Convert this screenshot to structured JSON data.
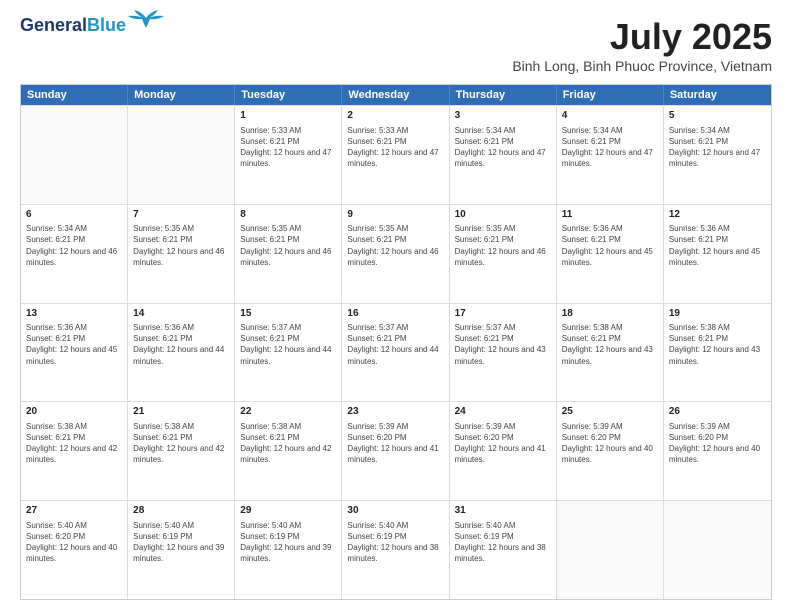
{
  "header": {
    "logo_line1": "General",
    "logo_line2": "Blue",
    "main_title": "July 2025",
    "subtitle": "Binh Long, Binh Phuoc Province, Vietnam"
  },
  "calendar": {
    "days_of_week": [
      "Sunday",
      "Monday",
      "Tuesday",
      "Wednesday",
      "Thursday",
      "Friday",
      "Saturday"
    ],
    "weeks": [
      [
        {
          "day": "",
          "empty": true
        },
        {
          "day": "",
          "empty": true
        },
        {
          "day": "1",
          "sunrise": "5:33 AM",
          "sunset": "6:21 PM",
          "daylight": "12 hours and 47 minutes."
        },
        {
          "day": "2",
          "sunrise": "5:33 AM",
          "sunset": "6:21 PM",
          "daylight": "12 hours and 47 minutes."
        },
        {
          "day": "3",
          "sunrise": "5:34 AM",
          "sunset": "6:21 PM",
          "daylight": "12 hours and 47 minutes."
        },
        {
          "day": "4",
          "sunrise": "5:34 AM",
          "sunset": "6:21 PM",
          "daylight": "12 hours and 47 minutes."
        },
        {
          "day": "5",
          "sunrise": "5:34 AM",
          "sunset": "6:21 PM",
          "daylight": "12 hours and 47 minutes."
        }
      ],
      [
        {
          "day": "6",
          "sunrise": "5:34 AM",
          "sunset": "6:21 PM",
          "daylight": "12 hours and 46 minutes."
        },
        {
          "day": "7",
          "sunrise": "5:35 AM",
          "sunset": "6:21 PM",
          "daylight": "12 hours and 46 minutes."
        },
        {
          "day": "8",
          "sunrise": "5:35 AM",
          "sunset": "6:21 PM",
          "daylight": "12 hours and 46 minutes."
        },
        {
          "day": "9",
          "sunrise": "5:35 AM",
          "sunset": "6:21 PM",
          "daylight": "12 hours and 46 minutes."
        },
        {
          "day": "10",
          "sunrise": "5:35 AM",
          "sunset": "6:21 PM",
          "daylight": "12 hours and 46 minutes."
        },
        {
          "day": "11",
          "sunrise": "5:36 AM",
          "sunset": "6:21 PM",
          "daylight": "12 hours and 45 minutes."
        },
        {
          "day": "12",
          "sunrise": "5:36 AM",
          "sunset": "6:21 PM",
          "daylight": "12 hours and 45 minutes."
        }
      ],
      [
        {
          "day": "13",
          "sunrise": "5:36 AM",
          "sunset": "6:21 PM",
          "daylight": "12 hours and 45 minutes."
        },
        {
          "day": "14",
          "sunrise": "5:36 AM",
          "sunset": "6:21 PM",
          "daylight": "12 hours and 44 minutes."
        },
        {
          "day": "15",
          "sunrise": "5:37 AM",
          "sunset": "6:21 PM",
          "daylight": "12 hours and 44 minutes."
        },
        {
          "day": "16",
          "sunrise": "5:37 AM",
          "sunset": "6:21 PM",
          "daylight": "12 hours and 44 minutes."
        },
        {
          "day": "17",
          "sunrise": "5:37 AM",
          "sunset": "6:21 PM",
          "daylight": "12 hours and 43 minutes."
        },
        {
          "day": "18",
          "sunrise": "5:38 AM",
          "sunset": "6:21 PM",
          "daylight": "12 hours and 43 minutes."
        },
        {
          "day": "19",
          "sunrise": "5:38 AM",
          "sunset": "6:21 PM",
          "daylight": "12 hours and 43 minutes."
        }
      ],
      [
        {
          "day": "20",
          "sunrise": "5:38 AM",
          "sunset": "6:21 PM",
          "daylight": "12 hours and 42 minutes."
        },
        {
          "day": "21",
          "sunrise": "5:38 AM",
          "sunset": "6:21 PM",
          "daylight": "12 hours and 42 minutes."
        },
        {
          "day": "22",
          "sunrise": "5:38 AM",
          "sunset": "6:21 PM",
          "daylight": "12 hours and 42 minutes."
        },
        {
          "day": "23",
          "sunrise": "5:39 AM",
          "sunset": "6:20 PM",
          "daylight": "12 hours and 41 minutes."
        },
        {
          "day": "24",
          "sunrise": "5:39 AM",
          "sunset": "6:20 PM",
          "daylight": "12 hours and 41 minutes."
        },
        {
          "day": "25",
          "sunrise": "5:39 AM",
          "sunset": "6:20 PM",
          "daylight": "12 hours and 40 minutes."
        },
        {
          "day": "26",
          "sunrise": "5:39 AM",
          "sunset": "6:20 PM",
          "daylight": "12 hours and 40 minutes."
        }
      ],
      [
        {
          "day": "27",
          "sunrise": "5:40 AM",
          "sunset": "6:20 PM",
          "daylight": "12 hours and 40 minutes."
        },
        {
          "day": "28",
          "sunrise": "5:40 AM",
          "sunset": "6:19 PM",
          "daylight": "12 hours and 39 minutes."
        },
        {
          "day": "29",
          "sunrise": "5:40 AM",
          "sunset": "6:19 PM",
          "daylight": "12 hours and 39 minutes."
        },
        {
          "day": "30",
          "sunrise": "5:40 AM",
          "sunset": "6:19 PM",
          "daylight": "12 hours and 38 minutes."
        },
        {
          "day": "31",
          "sunrise": "5:40 AM",
          "sunset": "6:19 PM",
          "daylight": "12 hours and 38 minutes."
        },
        {
          "day": "",
          "empty": true
        },
        {
          "day": "",
          "empty": true
        }
      ]
    ]
  }
}
